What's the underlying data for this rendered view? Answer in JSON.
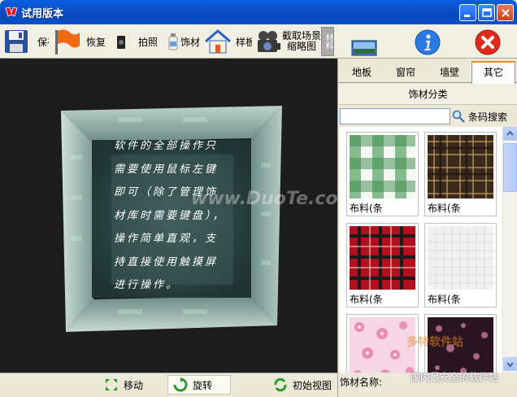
{
  "window": {
    "title": "试用版本"
  },
  "toolbar": {
    "save_label": "保存",
    "restore_label": "恢复",
    "photo_label": "拍照",
    "material_label": "饰材",
    "sample_label": "样板",
    "capture_label_line1": "截取场景",
    "capture_label_line2": "缩略图",
    "side_tab_label": "材料"
  },
  "viewport": {
    "watermark": "www.DuoTe.com",
    "cube_text": [
      "软件的全部操作只",
      "需要使用鼠标左键",
      "即可（除了管理饰",
      "材库时需要键盘），",
      "操作简单直观，支",
      "持直接使用触摸屏",
      "进行操作。"
    ]
  },
  "bottombar": {
    "move_label": "移动",
    "rotate_label": "旋转",
    "initial_view_label": "初始视图"
  },
  "panel": {
    "tabs": [
      "地板",
      "窗帘",
      "墙壁",
      "其它"
    ],
    "active_tab": 3,
    "category_label": "饰材分类",
    "search_value": "",
    "search_button_label": "条码搜索",
    "tiles": [
      {
        "label": "布料(条",
        "pattern": "green-gingham"
      },
      {
        "label": "布料(条",
        "pattern": "brown-plaid"
      },
      {
        "label": "布料(条",
        "pattern": "red-tartan"
      },
      {
        "label": "布料(条",
        "pattern": "white-weave"
      },
      {
        "label": "",
        "pattern": "pink-floral"
      },
      {
        "label": "",
        "pattern": "dark-floral"
      }
    ],
    "name_label": "饰材名称:"
  },
  "corner_watermark": {
    "line1": "多特软件站",
    "line2": "国内最安全的软件站"
  }
}
